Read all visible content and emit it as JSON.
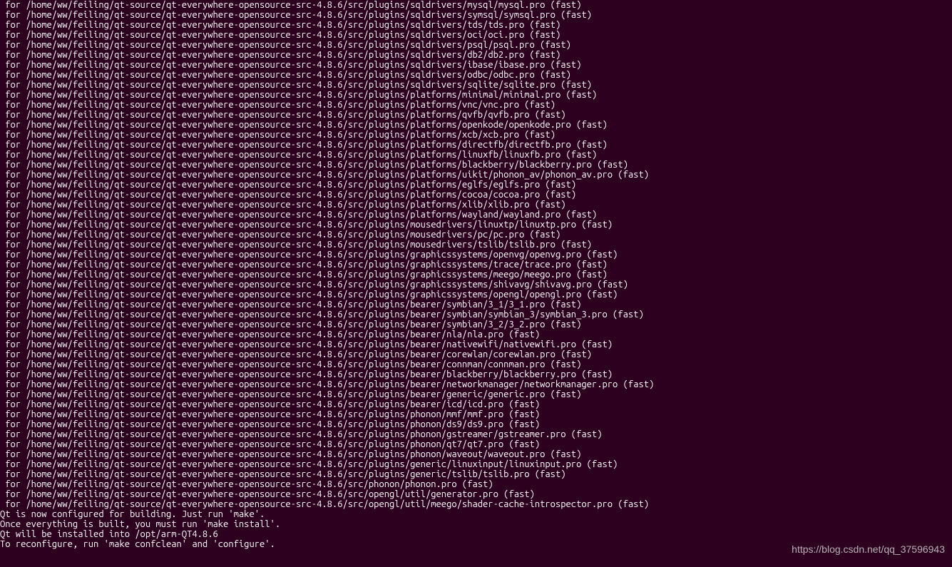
{
  "prefix": " for ",
  "basePath": "/home/ww/feiling/qt-source/qt-everywhere-opensource-src-4.8.6/",
  "suffix": " (fast)",
  "lines": [
    "src/plugins/sqldrivers/mysql/mysql.pro",
    "src/plugins/sqldrivers/symsql/symsql.pro",
    "src/plugins/sqldrivers/tds/tds.pro",
    "src/plugins/sqldrivers/oci/oci.pro",
    "src/plugins/sqldrivers/psql/psql.pro",
    "src/plugins/sqldrivers/db2/db2.pro",
    "src/plugins/sqldrivers/ibase/ibase.pro",
    "src/plugins/sqldrivers/odbc/odbc.pro",
    "src/plugins/sqldrivers/sqlite/sqlite.pro",
    "src/plugins/platforms/minimal/minimal.pro",
    "src/plugins/platforms/vnc/vnc.pro",
    "src/plugins/platforms/qvfb/qvfb.pro",
    "src/plugins/platforms/openkode/openkode.pro",
    "src/plugins/platforms/xcb/xcb.pro",
    "src/plugins/platforms/directfb/directfb.pro",
    "src/plugins/platforms/linuxfb/linuxfb.pro",
    "src/plugins/platforms/blackberry/blackberry.pro",
    "src/plugins/platforms/uikit/phonon_av/phonon_av.pro",
    "src/plugins/platforms/eglfs/eglfs.pro",
    "src/plugins/platforms/cocoa/cocoa.pro",
    "src/plugins/platforms/xlib/xlib.pro",
    "src/plugins/platforms/wayland/wayland.pro",
    "src/plugins/mousedrivers/linuxtp/linuxtp.pro",
    "src/plugins/mousedrivers/pc/pc.pro",
    "src/plugins/mousedrivers/tslib/tslib.pro",
    "src/plugins/graphicssystems/openvg/openvg.pro",
    "src/plugins/graphicssystems/trace/trace.pro",
    "src/plugins/graphicssystems/meego/meego.pro",
    "src/plugins/graphicssystems/shivavg/shivavg.pro",
    "src/plugins/graphicssystems/opengl/opengl.pro",
    "src/plugins/bearer/symbian/3_1/3_1.pro",
    "src/plugins/bearer/symbian/symbian_3/symbian_3.pro",
    "src/plugins/bearer/symbian/3_2/3_2.pro",
    "src/plugins/bearer/nla/nla.pro",
    "src/plugins/bearer/nativewifi/nativewifi.pro",
    "src/plugins/bearer/corewlan/corewlan.pro",
    "src/plugins/bearer/connman/connman.pro",
    "src/plugins/bearer/blackberry/blackberry.pro",
    "src/plugins/bearer/networkmanager/networkmanager.pro",
    "src/plugins/bearer/generic/generic.pro",
    "src/plugins/bearer/icd/icd.pro",
    "src/plugins/phonon/mmf/mmf.pro",
    "src/plugins/phonon/ds9/ds9.pro",
    "src/plugins/phonon/gstreamer/gstreamer.pro",
    "src/plugins/phonon/qt7/qt7.pro",
    "src/plugins/phonon/waveout/waveout.pro",
    "src/plugins/generic/linuxinput/linuxinput.pro",
    "src/plugins/generic/tslib/tslib.pro",
    "src/phonon/phonon.pro",
    "src/opengl/util/generator.pro",
    "src/opengl/util/meego/shader-cache-introspector.pro"
  ],
  "footer": [
    "",
    "Qt is now configured for building. Just run 'make'.",
    "Once everything is built, you must run 'make install'.",
    "Qt will be installed into /opt/arm-QT4.8.6",
    "",
    "To reconfigure, run 'make confclean' and 'configure'."
  ],
  "watermark": "https://blog.csdn.net/qq_37596943"
}
